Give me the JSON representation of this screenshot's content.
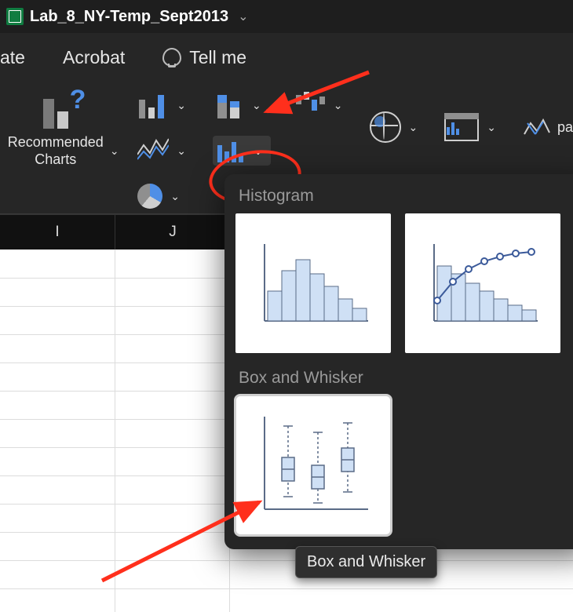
{
  "title": "Lab_8_NY-Temp_Sept2013",
  "ribbon": {
    "tabs": {
      "animate": "ate",
      "acrobat": "Acrobat",
      "tell_me": "Tell me"
    },
    "recommended_charts": "Recommended\nCharts",
    "sparklines_label_partial": "pa"
  },
  "columns": [
    "I",
    "J"
  ],
  "dropdown": {
    "section1": "Histogram",
    "section2": "Box and Whisker"
  },
  "tooltip": "Box and Whisker"
}
